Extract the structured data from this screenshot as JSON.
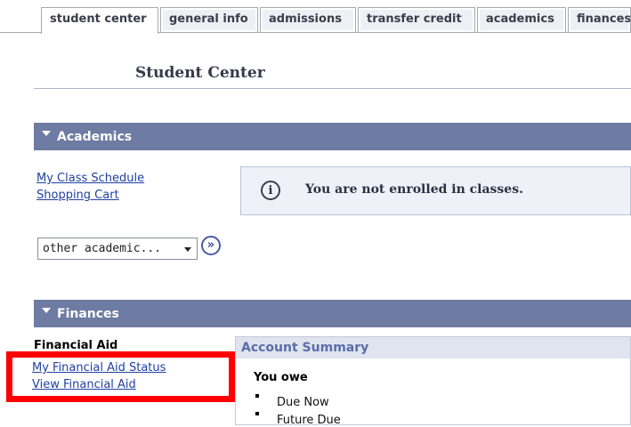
{
  "tabs": [
    {
      "label": "student center",
      "active": true
    },
    {
      "label": "general info",
      "active": false
    },
    {
      "label": "admissions",
      "active": false
    },
    {
      "label": "transfer credit",
      "active": false
    },
    {
      "label": "academics",
      "active": false
    },
    {
      "label": "finances",
      "active": false
    }
  ],
  "page_title": "Student Center",
  "academics": {
    "header": "Academics",
    "links": [
      "My Class Schedule",
      "Shopping Cart"
    ],
    "notice": "You are not enrolled in classes.",
    "select_value": "other academic...",
    "go_icon": "double-chevron-right-icon"
  },
  "finances": {
    "header": "Finances",
    "financial_aid_heading": "Financial Aid",
    "links": [
      "My Financial Aid Status",
      "View Financial Aid"
    ],
    "account_summary": {
      "header": "Account Summary",
      "you_owe": "You owe",
      "items": [
        "Due Now",
        "Future Due"
      ]
    }
  },
  "colors": {
    "section_header_bg": "#6e7ba2",
    "link": "#2040a0",
    "highlight": "#ff0000"
  }
}
